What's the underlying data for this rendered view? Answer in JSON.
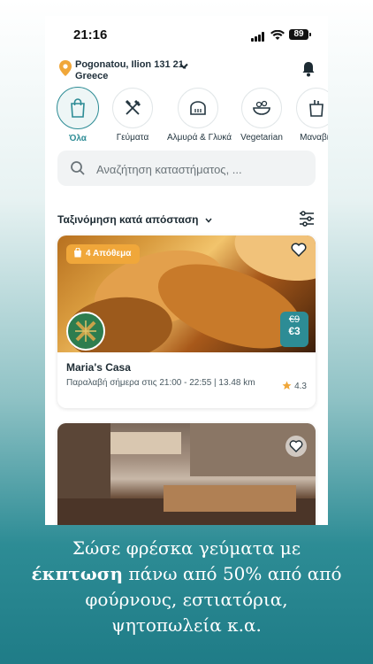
{
  "status": {
    "time": "21:16",
    "battery": "89"
  },
  "location": {
    "address": "Pogonatou, Ilion 131 21, Greece"
  },
  "categories": [
    {
      "label": "Όλα",
      "icon": "shopping-bag-icon",
      "active": true
    },
    {
      "label": "Γεύματα",
      "icon": "fork-knife-icon"
    },
    {
      "label": "Αλμυρά & Γλυκά",
      "icon": "bread-icon"
    },
    {
      "label": "Vegetarian",
      "icon": "salad-icon"
    },
    {
      "label": "Μαναβικ",
      "icon": "grocery-icon"
    }
  ],
  "search": {
    "placeholder": "Αναζήτηση καταστήματος, ..."
  },
  "sort": {
    "label": "Ταξινόμηση κατά απόσταση"
  },
  "listing1": {
    "badge": "4 Απόθεμα",
    "old_price": "€9",
    "new_price": "€3",
    "title": "Maria's Casa",
    "pickup": "Παραλαβή σήμερα στις 21:00 - 22:55 | 13.48 km",
    "rating": "4.3"
  },
  "caption": {
    "line1": "Σώσε φρέσκα γεύματα με",
    "bold": "έκπτωση",
    "line2_rest": " πάνω από 50% από από",
    "line3": "φούρνους, εστιατόρια,",
    "line4": "ψητοπωλεία κ.α."
  },
  "colors": {
    "accent": "#2d8c95",
    "badge": "#f0a73a",
    "logo": "#2d7d4f"
  }
}
